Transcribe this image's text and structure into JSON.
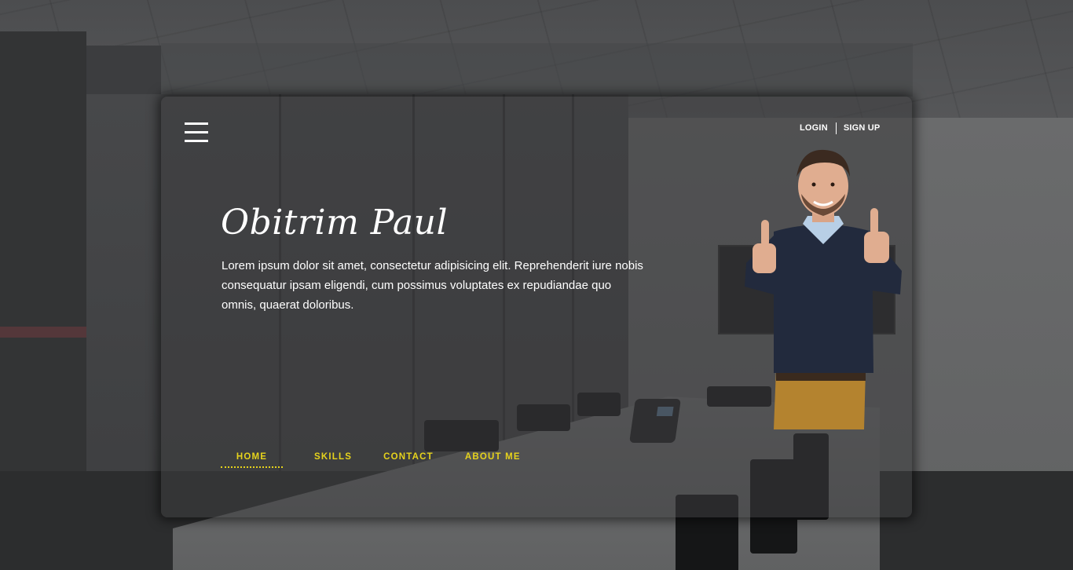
{
  "header": {
    "menu_icon": "hamburger-menu-icon",
    "login_label": "LOGIN",
    "signup_label": "SIGN UP"
  },
  "hero": {
    "name": "Obitrim Paul",
    "bio": "Lorem ipsum dolor sit amet, consectetur adipisicing elit. Reprehenderit iure nobis consequatur ipsam eligendi, cum possimus voluptates ex repudiandae quo omnis, quaerat doloribus."
  },
  "nav": {
    "items": [
      {
        "label": "HOME",
        "active": true
      },
      {
        "label": "SKILLS",
        "active": false
      },
      {
        "label": "CONTACT",
        "active": false
      },
      {
        "label": "ABOUT ME",
        "active": false
      }
    ]
  },
  "colors": {
    "accent": "#e6d31c",
    "text": "#ffffff",
    "card_bg": "#3c3d3e"
  }
}
